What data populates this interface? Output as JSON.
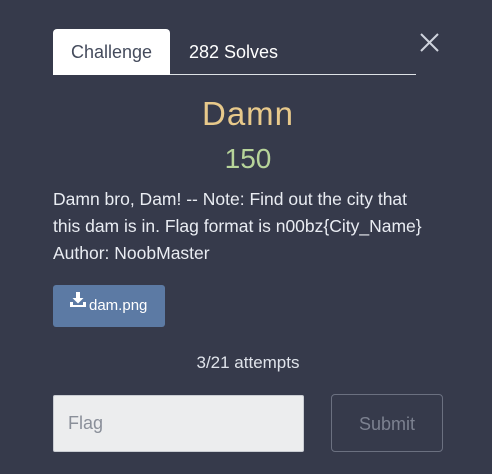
{
  "modal": {
    "tabs": [
      {
        "label": "Challenge",
        "active": true
      },
      {
        "label": "282 Solves",
        "active": false
      }
    ],
    "close_icon": "close-x-icon",
    "challenge": {
      "name": "Damn",
      "points": "150",
      "description_lines": [
        "Damn bro, Dam! -- Note: Find out the city that",
        "this dam is in. Flag format is n00bz{City_Name}",
        "Author: NoobMaster"
      ],
      "file": {
        "icon": "download-icon",
        "label": "dam.png"
      },
      "attempts": "3/21 attempts"
    },
    "form": {
      "flag_placeholder": "Flag",
      "flag_value": "",
      "submit_label": "Submit"
    }
  },
  "colors": {
    "background": "#363a4b",
    "title": "#e8c98b",
    "points": "#b7d49a",
    "file_button": "#5c7aa4"
  }
}
